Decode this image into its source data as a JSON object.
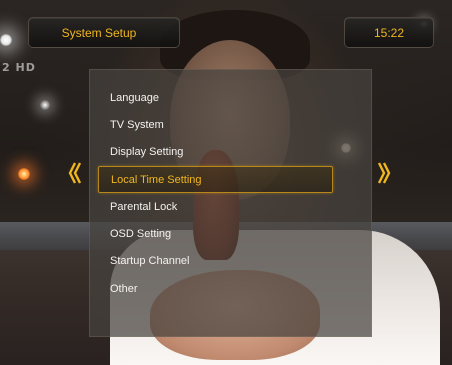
{
  "header": {
    "title": "System Setup",
    "clock": "15:22"
  },
  "channel_logo": "2 HD",
  "menu": {
    "items": [
      {
        "label": "Language"
      },
      {
        "label": "TV System"
      },
      {
        "label": "Display Setting"
      },
      {
        "label": "Local Time Setting"
      },
      {
        "label": "Parental Lock"
      },
      {
        "label": "OSD Setting"
      },
      {
        "label": "Startup Channel"
      },
      {
        "label": "Other"
      }
    ],
    "selected_index": 3
  },
  "nav": {
    "left_icon": "double-chevron-left-icon",
    "right_icon": "double-chevron-right-icon"
  },
  "colors": {
    "accent": "#f0b61e",
    "menu_text": "#f4f2ef",
    "panel_bg": "#46423e"
  }
}
